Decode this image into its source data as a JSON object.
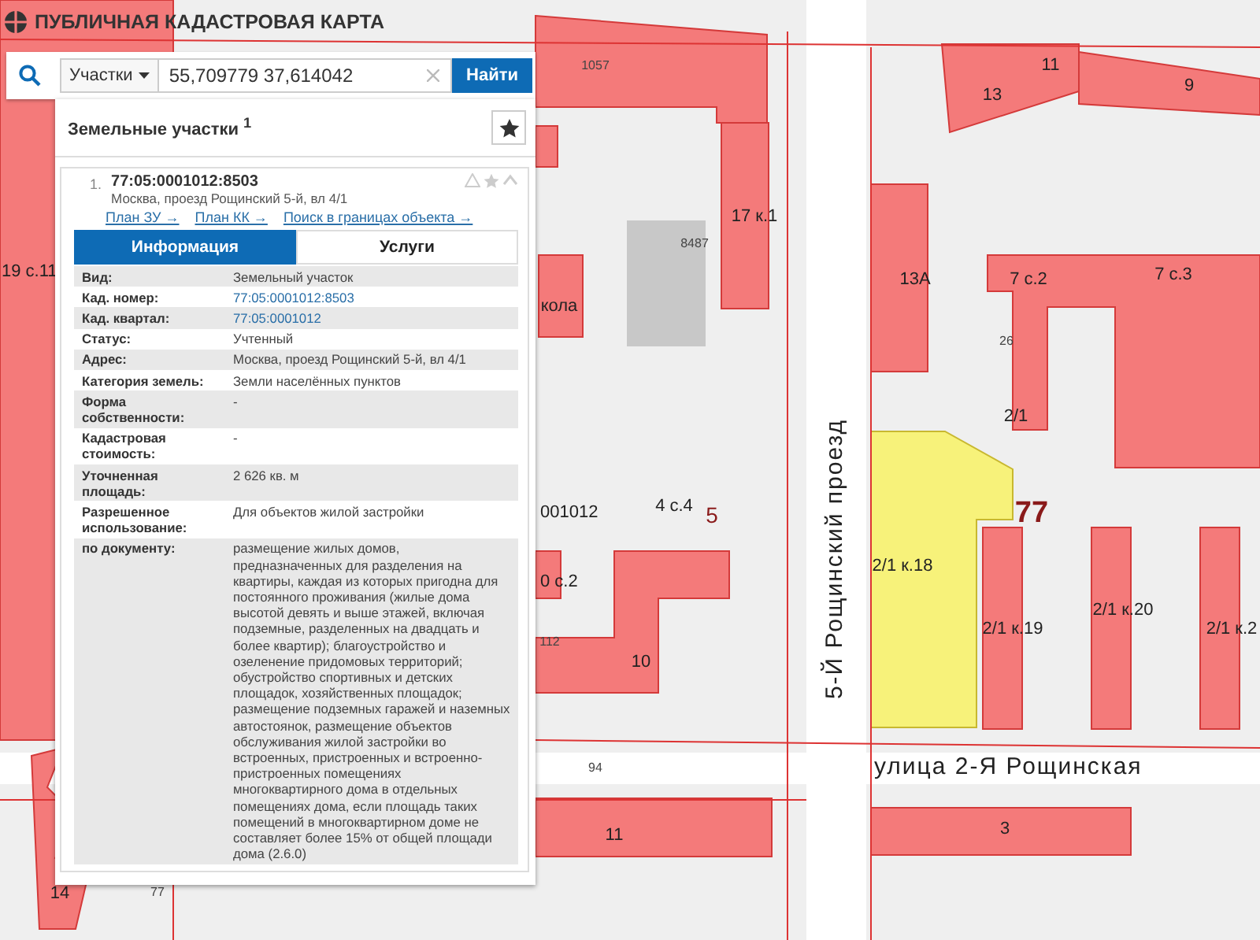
{
  "app": {
    "title": "ПУБЛИЧНАЯ КАДАСТРОВАЯ КАРТА"
  },
  "search": {
    "category": "Участки",
    "value": "55,709779 37,614042",
    "button": "Найти"
  },
  "results": {
    "title": "Земельные участки $^{1}$"
  },
  "item": {
    "index": "1.",
    "number": "77:05:0001012:8503",
    "address": "Москва, проезд Рощинский 5-й, вл 4/1",
    "links": [
      "План ЗУ →",
      "План КК →",
      "Поиск в границах объекта →"
    ]
  },
  "tabs": [
    {
      "label": "Информация",
      "selected": true
    },
    {
      "label": "Услуги",
      "selected": false
    }
  ],
  "rows": [
    {
      "label": "Вид:",
      "value": "Земельный участок",
      "kind": "text"
    },
    {
      "label": "Кад. номер:",
      "value": "77:05:0001012:8503",
      "kind": "link"
    },
    {
      "label": "Кад. квартал:",
      "value": "77:05:0001012",
      "kind": "link"
    },
    {
      "label": "Статус:",
      "value": "Учтенный",
      "kind": "text"
    },
    {
      "label": "Адрес:",
      "value": "Москва, проезд Рощинский 5-й, вл 4/1",
      "kind": "text"
    },
    {
      "label": "Категория земель:",
      "value": "Земли населённых пунктов",
      "kind": "text"
    },
    {
      "label": "Форма собственности:",
      "value": "-",
      "kind": "text"
    },
    {
      "label": "Кадастровая стоимость:",
      "value": "-",
      "kind": "text"
    },
    {
      "label": "Уточненная площадь:",
      "value": "2 626 кв. м",
      "kind": "text"
    },
    {
      "label": "Разрешенное использование:",
      "value": "Для объектов жилой застройки",
      "kind": "text"
    },
    {
      "label": "по документу:",
      "value": "размещение жилых домов, предназначенных для разделения на квартиры, каждая из которых пригодна для постоянного проживания (жилые дома высотой девять и выше этажей, включая подземные, разделенных на двадцать и более квартир); благоустройство и озеленение придомовых территорий; обустройство спортивных и детских площадок, хозяйственных площадок; размещение подземных гаражей и наземных автостоянок, размещение объектов обслуживания жилой застройки во встроенных, пристроенных и встроенно-пристроенных помещениях многоквартирного дома в отдельных помещениях дома, если площадь таких помещений в многоквартирном доме не составляет более 15% от общей площади дома (2.6.0)",
      "kind": "text"
    }
  ],
  "map_labels": [
    {
      "text": "1057",
      "kind": "small"
    },
    {
      "text": "11",
      "kind": "building"
    },
    {
      "text": "13",
      "kind": "building"
    },
    {
      "text": "9",
      "kind": "building"
    },
    {
      "text": "17 к.1",
      "kind": "building"
    },
    {
      "text": "8487",
      "kind": "small"
    },
    {
      "text": "кола",
      "kind": "building"
    },
    {
      "text": "13А",
      "kind": "building"
    },
    {
      "text": "7 с.2",
      "kind": "building"
    },
    {
      "text": "7 с.3",
      "kind": "building"
    },
    {
      "text": "26",
      "kind": "small"
    },
    {
      "text": "2/1",
      "kind": "building"
    },
    {
      "text": "19 с.11",
      "kind": "building"
    },
    {
      "text": "001012",
      "kind": "building"
    },
    {
      "text": "4 с.4",
      "kind": "building"
    },
    {
      "text": "5",
      "kind": "quarter"
    },
    {
      "text": "77",
      "kind": "region"
    },
    {
      "text": "2/1 к.18",
      "kind": "building"
    },
    {
      "text": "2/1 к.19",
      "kind": "building"
    },
    {
      "text": "2/1 к.20",
      "kind": "building"
    },
    {
      "text": "2/1 к.2",
      "kind": "building"
    },
    {
      "text": "0 с.2",
      "kind": "building"
    },
    {
      "text": "112",
      "kind": "small"
    },
    {
      "text": "10",
      "kind": "building"
    },
    {
      "text": "94",
      "kind": "small"
    },
    {
      "text": "11",
      "kind": "building"
    },
    {
      "text": "3",
      "kind": "building"
    },
    {
      "text": "14",
      "kind": "building"
    },
    {
      "text": "77",
      "kind": "small"
    }
  ],
  "streets": [
    {
      "text": "5-Й Рощинский проезд",
      "kind": "vertical"
    },
    {
      "text": "улица 2-Я Рощинская",
      "kind": "horizontal"
    }
  ]
}
